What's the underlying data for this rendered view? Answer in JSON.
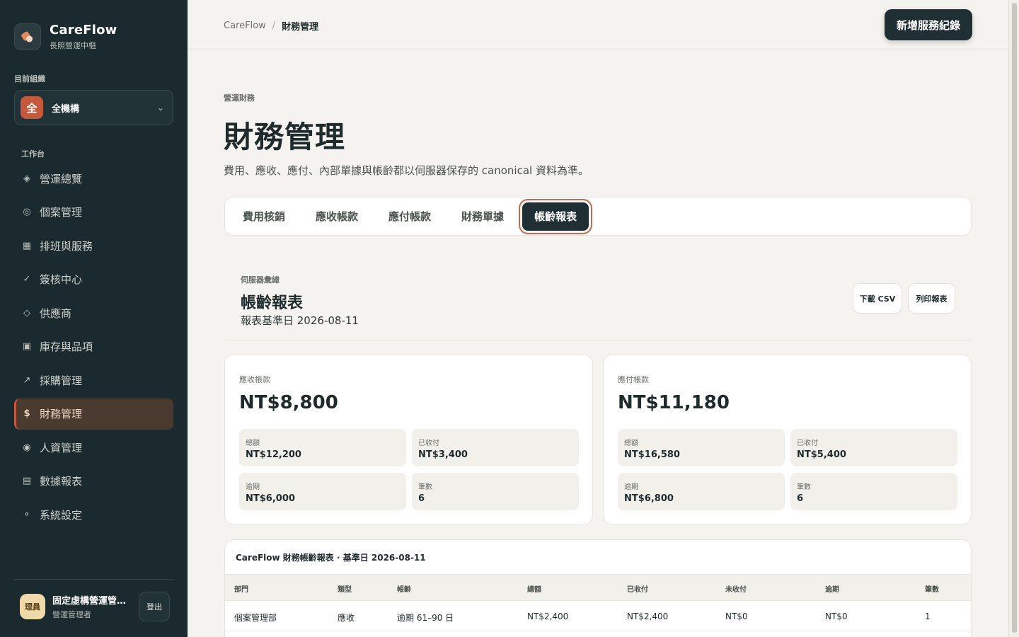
{
  "brand": {
    "name": "CareFlow",
    "subtitle": "長照營運中樞",
    "logo_icon": "careflow-logo-icon"
  },
  "org": {
    "label": "目前組織",
    "badge": "全",
    "name": "全機構",
    "badge_color": "#c4593d"
  },
  "sidebar": {
    "section_label": "工作台",
    "items": [
      {
        "icon": "diamond-icon",
        "glyph": "◈",
        "label": "營運總覽"
      },
      {
        "icon": "ring-icon",
        "glyph": "◎",
        "label": "個案管理"
      },
      {
        "icon": "grid-icon",
        "glyph": "▦",
        "label": "排班與服務"
      },
      {
        "icon": "check-icon",
        "glyph": "✓",
        "label": "簽核中心"
      },
      {
        "icon": "diamond-outline-icon",
        "glyph": "◇",
        "label": "供應商"
      },
      {
        "icon": "box-icon",
        "glyph": "▣",
        "label": "庫存與品項"
      },
      {
        "icon": "arrow-up-right-icon",
        "glyph": "↗",
        "label": "採購管理"
      },
      {
        "icon": "dollar-icon",
        "glyph": "$",
        "label": "財務管理",
        "active": true
      },
      {
        "icon": "dot-circle-icon",
        "glyph": "◉",
        "label": "人資管理"
      },
      {
        "icon": "list-icon",
        "glyph": "▤",
        "label": "數據報表"
      },
      {
        "icon": "settings-dot-icon",
        "glyph": "⚬",
        "label": "系統設定"
      }
    ],
    "accent_color": "#c4593d"
  },
  "user": {
    "avatar": "理員",
    "name": "固定虛構營運管理員",
    "role": "營運管理者",
    "logout": "登出"
  },
  "topbar": {
    "breadcrumb": {
      "root": "CareFlow",
      "separator": "/",
      "current": "財務管理"
    },
    "primary_button": "新增服務紀錄"
  },
  "page": {
    "eyebrow": "營運財務",
    "title": "財務管理",
    "description": "費用、應收、應付、內部單據與帳齡都以伺服器保存的 canonical 資料為準。"
  },
  "tabs": [
    {
      "label": "費用核銷"
    },
    {
      "label": "應收帳款"
    },
    {
      "label": "應付帳款"
    },
    {
      "label": "財務單據"
    },
    {
      "label": "帳齡報表",
      "active": true
    }
  ],
  "report": {
    "eyebrow": "伺服器彙總",
    "title": "帳齡報表",
    "base_date": "報表基準日 2026-08-11",
    "csv_button": "下載 CSV",
    "print_button": "列印報表"
  },
  "receivable": {
    "label": "應收帳款",
    "amount": "NT$8,800",
    "total_label": "總額",
    "total": "NT$12,200",
    "paid_label": "已收付",
    "paid": "NT$3,400",
    "overdue_label": "逾期",
    "overdue": "NT$6,000",
    "count_label": "筆數",
    "count": "6"
  },
  "payable": {
    "label": "應付帳款",
    "amount": "NT$11,180",
    "total_label": "總額",
    "total": "NT$16,580",
    "paid_label": "已收付",
    "paid": "NT$5,400",
    "overdue_label": "逾期",
    "overdue": "NT$6,800",
    "count_label": "筆數",
    "count": "6"
  },
  "table": {
    "title": "CareFlow 財務帳齡報表 · 基準日 2026-08-11",
    "headers": [
      "部門",
      "類型",
      "帳齡",
      "總額",
      "已收付",
      "未收付",
      "逾期",
      "筆數"
    ],
    "rows": [
      [
        "個案管理部",
        "應收",
        "逾期 61–90 日",
        "NT$2,400",
        "NT$2,400",
        "NT$0",
        "NT$0",
        "1"
      ]
    ]
  }
}
